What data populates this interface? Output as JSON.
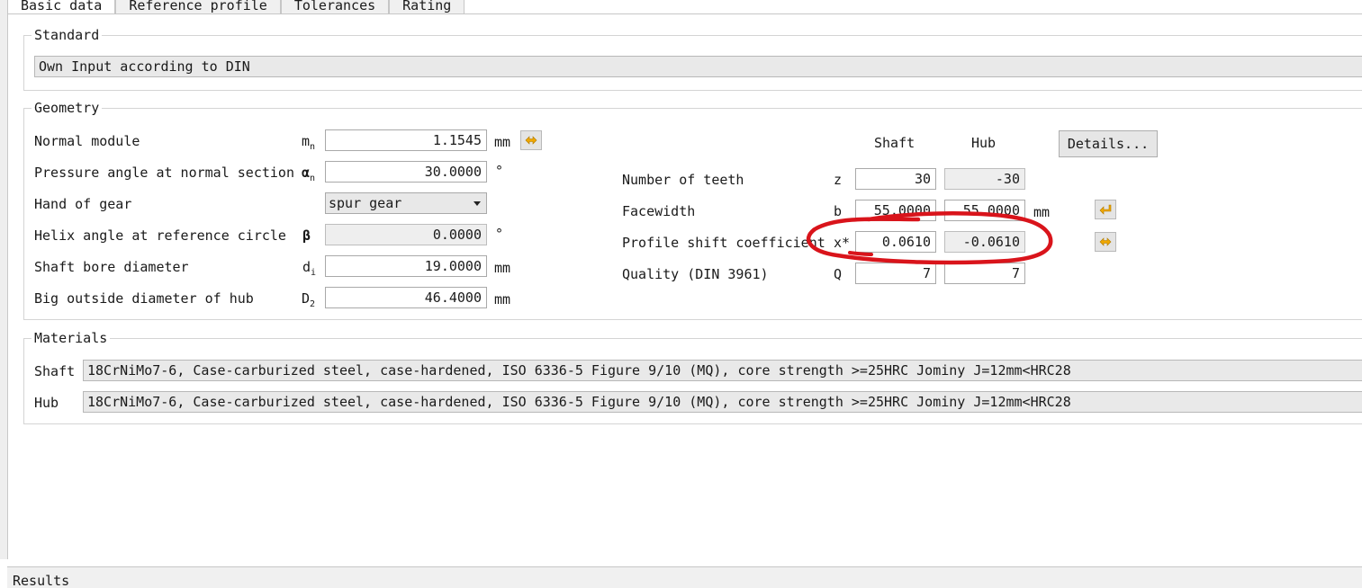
{
  "tabs": [
    {
      "label": "Basic data",
      "active": true
    },
    {
      "label": "Reference profile",
      "active": false
    },
    {
      "label": "Tolerances",
      "active": false
    },
    {
      "label": "Rating",
      "active": false
    }
  ],
  "standard": {
    "title": "Standard",
    "value": "Own Input according to DIN"
  },
  "geometry": {
    "title": "Geometry",
    "rows": [
      {
        "label": "Normal module",
        "symbol": "m",
        "sub": "n",
        "value": "1.1545",
        "unit": "mm"
      },
      {
        "label": "Pressure angle at normal section",
        "symbol": "α",
        "sub": "n",
        "value": "30.0000",
        "unit": "°"
      },
      {
        "label": "Hand of gear",
        "symbol": "",
        "sub": "",
        "value": "spur gear",
        "unit": ""
      },
      {
        "label": "Helix angle at reference circle",
        "symbol": "β",
        "sub": "",
        "value": "0.0000",
        "unit": "°"
      },
      {
        "label": "Shaft bore diameter",
        "symbol": "d",
        "sub": "i",
        "value": "19.0000",
        "unit": "mm"
      },
      {
        "label": "Big outside diameter of hub",
        "symbol": "D",
        "sub": "2",
        "value": "46.4000",
        "unit": "mm"
      }
    ],
    "col_shaft": "Shaft",
    "col_hub": "Hub",
    "details_label": "Details...",
    "right_rows": [
      {
        "label": "Number of teeth",
        "symbol": "z",
        "shaft": "30",
        "hub": "-30",
        "unit": ""
      },
      {
        "label": "Facewidth",
        "symbol": "b",
        "shaft": "55.0000",
        "hub": "55.0000",
        "unit": "mm"
      },
      {
        "label": "Profile shift coefficient",
        "symbol": "x*",
        "shaft": "0.0610",
        "hub": "-0.0610",
        "unit": ""
      },
      {
        "label": "Quality (DIN 3961)",
        "symbol": "Q",
        "shaft": "7",
        "hub": "7",
        "unit": ""
      }
    ]
  },
  "materials": {
    "title": "Materials",
    "shaft_label": "Shaft",
    "shaft_value": "18CrNiMo7-6, Case-carburized steel, case-hardened, ISO 6336-5 Figure 9/10 (MQ), core strength >=25HRC Jominy J=12mm<HRC28",
    "hub_label": "Hub",
    "hub_value": "18CrNiMo7-6, Case-carburized steel, case-hardened, ISO 6336-5 Figure 9/10 (MQ), core strength >=25HRC Jominy J=12mm<HRC28"
  },
  "results_label": "Results",
  "colors": {
    "annotation": "#d9141b",
    "icon_arrow": "#f0a800"
  },
  "icons": [
    "swap-arrows-icon",
    "enter-arrow-icon",
    "dropdown-arrow-icon"
  ]
}
